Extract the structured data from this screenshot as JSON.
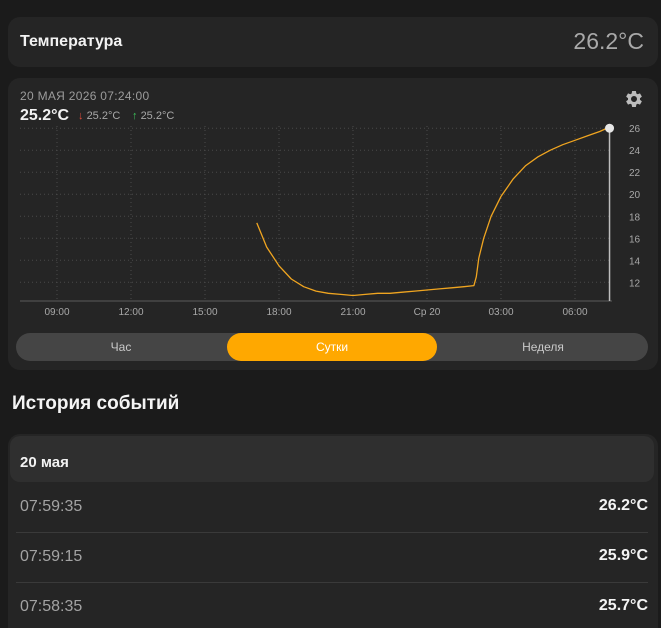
{
  "header": {
    "title": "Температура",
    "value": "26.2°C"
  },
  "chart_panel": {
    "timestamp": "20 МАЯ 2026 07:24:00",
    "current": "25.2°C",
    "min": "25.2°C",
    "max": "25.2°C",
    "settings_icon": "gear-icon"
  },
  "range_tabs": {
    "hour": "Час",
    "day": "Сутки",
    "week": "Неделя",
    "selected": "day"
  },
  "history": {
    "title": "История событий",
    "date": "20 мая",
    "rows": [
      {
        "time": "07:59:35",
        "value": "26.2°C"
      },
      {
        "time": "07:59:15",
        "value": "25.9°C"
      },
      {
        "time": "07:58:35",
        "value": "25.7°C"
      }
    ]
  },
  "colors": {
    "accent": "#ffa800",
    "line": "#f0a520",
    "down": "#e04b3a",
    "up": "#3cc25a"
  },
  "chart_data": {
    "type": "line",
    "x_tick_labels": [
      "09:00",
      "12:00",
      "15:00",
      "18:00",
      "21:00",
      "Ср 20",
      "03:00",
      "06:00"
    ],
    "x_hours": [
      9,
      12,
      15,
      18,
      21,
      24,
      27,
      30
    ],
    "xlim": [
      7.5,
      31.5
    ],
    "y_ticks": [
      12,
      14,
      16,
      18,
      20,
      22,
      24,
      26
    ],
    "ylim": [
      10.3,
      26.2
    ],
    "series": [
      {
        "x": [
          17.1,
          17.5,
          18.0,
          18.5,
          19.0,
          19.5,
          20.0,
          20.5,
          21.0,
          21.5,
          22.0,
          22.5,
          23.0,
          23.5,
          24.0,
          24.5,
          25.0,
          25.5,
          25.9,
          26.0,
          26.1,
          26.3,
          26.6,
          27.0,
          27.5,
          28.0,
          28.5,
          29.0,
          29.5,
          30.0,
          30.5,
          31.0,
          31.4
        ],
        "y": [
          17.4,
          15.2,
          13.5,
          12.3,
          11.6,
          11.2,
          11.0,
          10.9,
          10.8,
          10.9,
          11.0,
          11.0,
          11.1,
          11.2,
          11.3,
          11.4,
          11.5,
          11.6,
          11.7,
          12.5,
          14.2,
          16.0,
          18.0,
          19.8,
          21.4,
          22.6,
          23.4,
          24.0,
          24.5,
          24.9,
          25.3,
          25.7,
          26.1
        ]
      }
    ],
    "cursor_x": 31.4,
    "cursor_y": 25.2,
    "grid": true
  }
}
